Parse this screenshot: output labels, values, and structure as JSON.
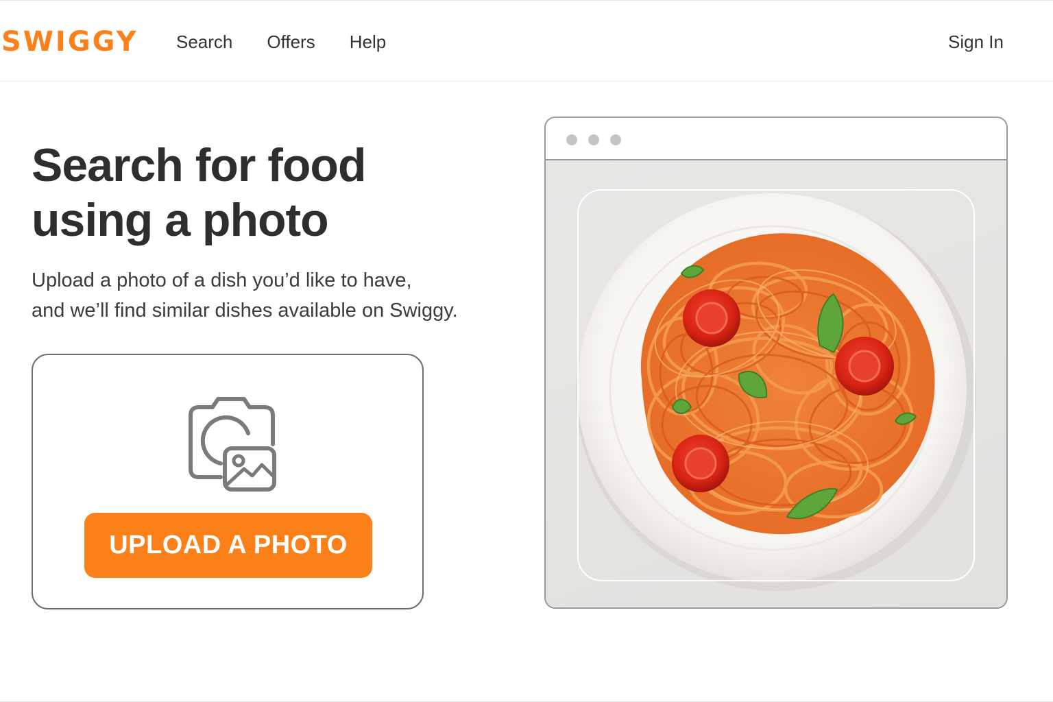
{
  "header": {
    "logo": "SWIGGY",
    "nav": [
      "Search",
      "Offers",
      "Help"
    ],
    "signin": "Sign In"
  },
  "hero": {
    "title_lines": [
      "Search for food",
      "using a photo"
    ],
    "subtitle_lines": [
      "Upload a photo of a dish you’d like to have,",
      "and we’ll find similar dishes available on Swiggy."
    ]
  },
  "upload": {
    "icon": "camera-image-icon",
    "button_label": "UPLOAD A PHOTO"
  },
  "preview": {
    "image": "spaghetti-tomato-basil-plate"
  },
  "colors": {
    "brand": "#fc8019",
    "text": "#2e2e2e",
    "border": "#6e6e6e"
  }
}
